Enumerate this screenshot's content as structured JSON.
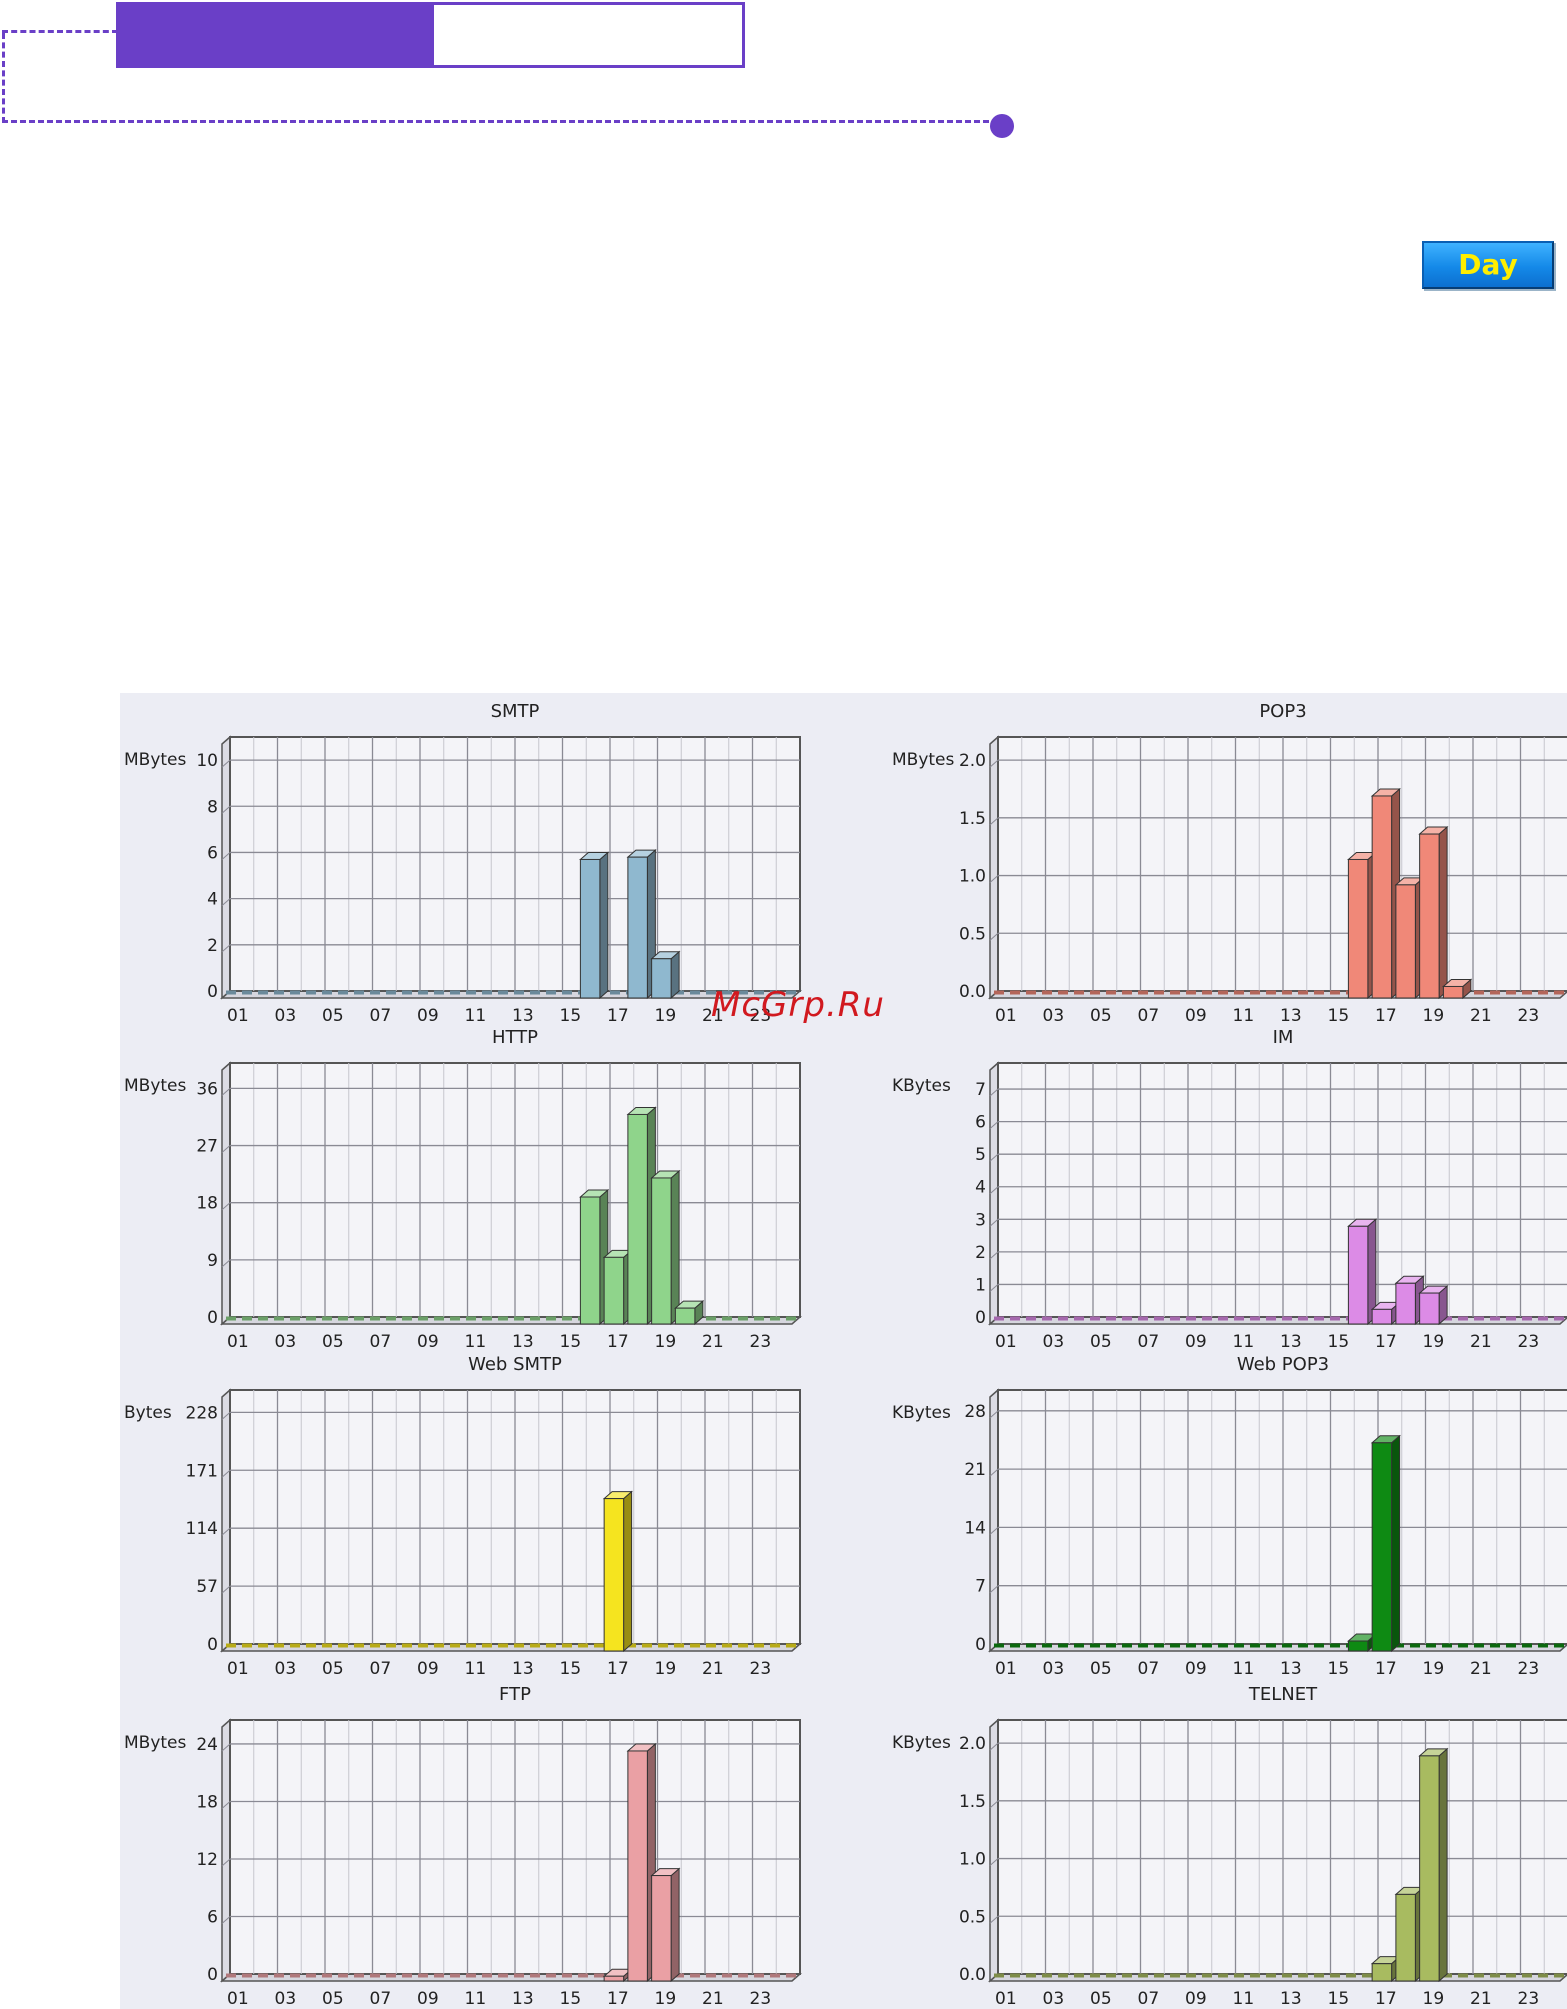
{
  "header": {
    "accent_color": "#6a3fc7"
  },
  "day_button": {
    "label": "Day"
  },
  "watermark": {
    "text": "McGrp.Ru"
  },
  "chart_data": [
    {
      "type": "bar",
      "title": "SMTP",
      "ylabel": "MBytes",
      "color": "#8fb8cf",
      "yticks": [
        "0",
        "2",
        "4",
        "6",
        "8",
        "10"
      ],
      "ylim": [
        0,
        11
      ],
      "xticks": [
        "01",
        "03",
        "05",
        "07",
        "09",
        "11",
        "13",
        "15",
        "17",
        "19",
        "21",
        "23"
      ],
      "hours": [
        "16",
        "18",
        "19"
      ],
      "values": [
        6.0,
        6.1,
        1.7
      ]
    },
    {
      "type": "bar",
      "title": "POP3",
      "ylabel": "MBytes",
      "color": "#f08878",
      "yticks": [
        "0.0",
        "0.5",
        "1.0",
        "1.5",
        "2.0"
      ],
      "ylim": [
        0,
        2.2
      ],
      "xticks": [
        "01",
        "03",
        "05",
        "07",
        "09",
        "11",
        "13",
        "15",
        "17",
        "19",
        "21",
        "23"
      ],
      "hours": [
        "16",
        "17",
        "18",
        "19",
        "20"
      ],
      "values": [
        1.2,
        1.75,
        0.98,
        1.42,
        0.1
      ]
    },
    {
      "type": "bar",
      "title": "HTTP",
      "ylabel": "MBytes",
      "color": "#8fd48b",
      "yticks": [
        "0",
        "9",
        "18",
        "27",
        "36"
      ],
      "ylim": [
        0,
        40
      ],
      "xticks": [
        "01",
        "03",
        "05",
        "07",
        "09",
        "11",
        "13",
        "15",
        "17",
        "19",
        "21",
        "23"
      ],
      "hours": [
        "16",
        "17",
        "18",
        "19",
        "20"
      ],
      "values": [
        20,
        10.5,
        33,
        23,
        2.5
      ]
    },
    {
      "type": "bar",
      "title": "IM",
      "ylabel": "KBytes",
      "color": "#dc8be6",
      "yticks": [
        "0",
        "1",
        "2",
        "3",
        "4",
        "5",
        "6",
        "7"
      ],
      "ylim": [
        0,
        7.8
      ],
      "xticks": [
        "01",
        "03",
        "05",
        "07",
        "09",
        "11",
        "13",
        "15",
        "17",
        "19",
        "21",
        "23"
      ],
      "hours": [
        "16",
        "17",
        "18",
        "19"
      ],
      "values": [
        3.0,
        0.45,
        1.25,
        0.95
      ]
    },
    {
      "type": "bar",
      "title": "Web SMTP",
      "ylabel": "Bytes",
      "color": "#f5e41f",
      "yticks": [
        "0",
        "57",
        "114",
        "171",
        "228"
      ],
      "ylim": [
        0,
        250
      ],
      "xticks": [
        "01",
        "03",
        "05",
        "07",
        "09",
        "11",
        "13",
        "15",
        "17",
        "19",
        "21",
        "23"
      ],
      "hours": [
        "17"
      ],
      "values": [
        150
      ]
    },
    {
      "type": "bar",
      "title": "Web POP3",
      "ylabel": "KBytes",
      "color": "#0e8a13",
      "yticks": [
        "0",
        "7",
        "14",
        "21",
        "28"
      ],
      "ylim": [
        0,
        30.5
      ],
      "xticks": [
        "01",
        "03",
        "05",
        "07",
        "09",
        "11",
        "13",
        "15",
        "17",
        "19",
        "21",
        "23"
      ],
      "hours": [
        "16",
        "17"
      ],
      "values": [
        1.2,
        25
      ]
    },
    {
      "type": "bar",
      "title": "FTP",
      "ylabel": "MBytes",
      "color": "#eaa0a4",
      "yticks": [
        "0",
        "6",
        "12",
        "18",
        "24"
      ],
      "ylim": [
        0,
        26.5
      ],
      "xticks": [
        "01",
        "03",
        "05",
        "07",
        "09",
        "11",
        "13",
        "15",
        "17",
        "19",
        "21",
        "23"
      ],
      "hours": [
        "17",
        "18",
        "19"
      ],
      "values": [
        0.5,
        24,
        11
      ]
    },
    {
      "type": "bar",
      "title": "TELNET",
      "ylabel": "KBytes",
      "color": "#a8bb60",
      "yticks": [
        "0.0",
        "0.5",
        "1.0",
        "1.5",
        "2.0"
      ],
      "ylim": [
        0,
        2.2
      ],
      "xticks": [
        "01",
        "03",
        "05",
        "07",
        "09",
        "11",
        "13",
        "15",
        "17",
        "19",
        "21",
        "23"
      ],
      "hours": [
        "17",
        "18",
        "19"
      ],
      "values": [
        0.15,
        0.75,
        1.95
      ]
    }
  ]
}
